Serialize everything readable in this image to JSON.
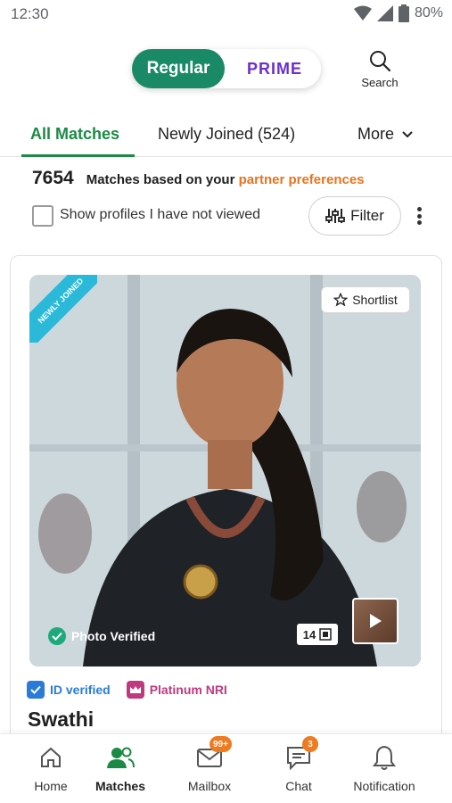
{
  "status_bar": {
    "time": "12:30",
    "battery_percent": "80%"
  },
  "header": {
    "toggle": {
      "regular_label": "Regular",
      "prime_label": "PRIME"
    },
    "search_label": "Search"
  },
  "tabs": {
    "all_matches": "All Matches",
    "newly_joined": "Newly Joined (524)",
    "more": "More"
  },
  "matches": {
    "count": "7654",
    "text_prefix": "Matches based on your",
    "link_text": "partner preferences"
  },
  "filters": {
    "checkbox_label": "Show profiles I have not viewed",
    "filter_label": "Filter"
  },
  "profile_card": {
    "ribbon_text": "NEWLY JOINED",
    "shortlist_label": "Shortlist",
    "photo_verified_label": "Photo Verified",
    "photo_count": "14",
    "id_verified_label": "ID verified",
    "membership_label": "Platinum NRI",
    "name": "Swathi"
  },
  "bottom_nav": [
    {
      "label": "Home",
      "icon": "home-icon"
    },
    {
      "label": "Matches",
      "icon": "matches-icon",
      "active": true
    },
    {
      "label": "Mailbox",
      "icon": "mailbox-icon",
      "badge": "99+"
    },
    {
      "label": "Chat",
      "icon": "chat-icon",
      "badge": "3"
    },
    {
      "label": "Notification",
      "icon": "bell-icon"
    }
  ],
  "colors": {
    "primary_green": "#1a8a66",
    "tab_active": "#1a8a44",
    "prime_purple": "#6b2fcc",
    "link_orange": "#e8731e",
    "ribbon_cyan": "#2bb9d9",
    "badge_orange": "#ee7a21"
  }
}
